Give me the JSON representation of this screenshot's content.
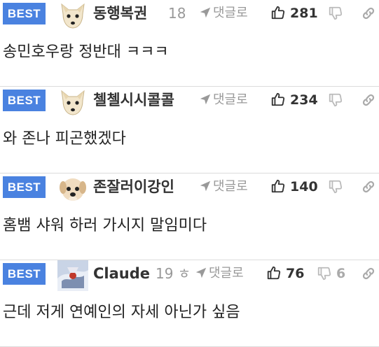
{
  "comments": [
    {
      "badge": "BEST",
      "nickname": "동행복권",
      "time": "18",
      "reply_label": "댓글로",
      "likes": "281",
      "dislikes": "",
      "text": "송민호우랑 정반대 ㅋㅋㅋ",
      "avatar": "dog-avatar"
    },
    {
      "badge": "BEST",
      "nickname": "첼첼시시콜콜",
      "time": "",
      "reply_label": "댓글로",
      "likes": "234",
      "dislikes": "",
      "text": "와 존나 피곤했겠다",
      "avatar": "dog-avatar"
    },
    {
      "badge": "BEST",
      "nickname": "존잘러이강인",
      "time": "",
      "reply_label": "댓글로",
      "likes": "140",
      "dislikes": "",
      "text": "홈뱀 샤워 하러 가시지 말임미다",
      "avatar": "puppy-avatar"
    },
    {
      "badge": "BEST",
      "nickname": "Claude",
      "time": "19 ㅎ",
      "reply_label": "댓글로",
      "likes": "76",
      "dislikes": "6",
      "text": "근데 저게 연예인의 자세 아닌가 싶음",
      "avatar": "photo-avatar"
    }
  ],
  "icons": {
    "reply": "send-arrow-icon",
    "like": "thumbs-up-icon",
    "dislike": "thumbs-down-icon",
    "link": "link-icon"
  },
  "colors": {
    "badge": "#4a82e0",
    "muted": "#999999",
    "text": "#222222"
  }
}
